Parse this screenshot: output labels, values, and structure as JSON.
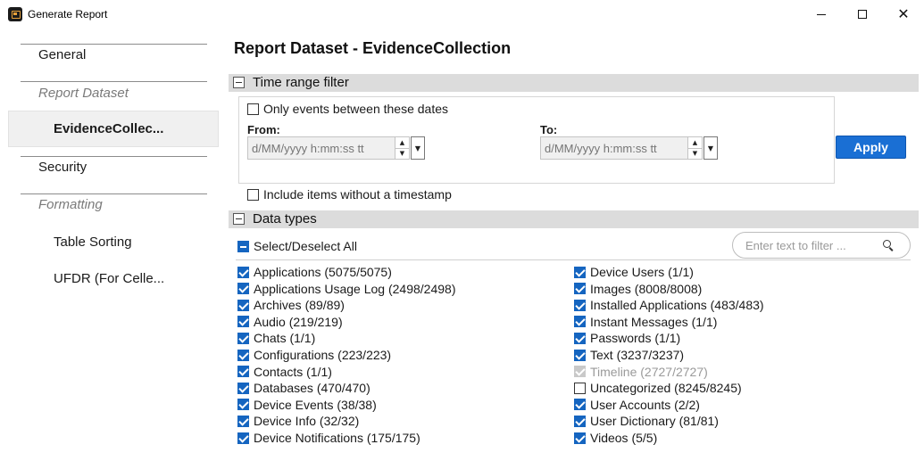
{
  "window": {
    "title": "Generate Report",
    "icon": "report-app-icon",
    "controls": [
      "minimize",
      "maximize",
      "close"
    ],
    "close_glyph": "✕"
  },
  "nav": {
    "general": "General",
    "report_dataset": "Report Dataset",
    "evidence": "EvidenceCollec...",
    "security": "Security",
    "formatting": "Formatting",
    "table_sorting": "Table Sorting",
    "ufdr": "UFDR (For Celle..."
  },
  "main": {
    "title": "Report Dataset - EvidenceCollection",
    "time_range": {
      "section_title": "Time range filter",
      "only_events_label": "Only events between these dates",
      "only_events_checked": false,
      "from_label": "From:",
      "to_label": "To:",
      "date_placeholder": "d/MM/yyyy h:mm:ss tt",
      "apply_label": "Apply",
      "include_label": "Include items without a timestamp",
      "include_checked": false
    },
    "data_types": {
      "section_title": "Data types",
      "select_all_label": "Select/Deselect All",
      "select_all_state": "indeterminate",
      "filter_placeholder": "Enter text to filter ...",
      "left_items": [
        {
          "label": "Applications (5075/5075)",
          "checked": true
        },
        {
          "label": "Applications Usage Log (2498/2498)",
          "checked": true
        },
        {
          "label": "Archives (89/89)",
          "checked": true
        },
        {
          "label": "Audio (219/219)",
          "checked": true
        },
        {
          "label": "Chats (1/1)",
          "checked": true
        },
        {
          "label": "Configurations (223/223)",
          "checked": true
        },
        {
          "label": "Contacts (1/1)",
          "checked": true
        },
        {
          "label": "Databases (470/470)",
          "checked": true
        },
        {
          "label": "Device Events (38/38)",
          "checked": true
        },
        {
          "label": "Device Info (32/32)",
          "checked": true
        },
        {
          "label": "Device Notifications (175/175)",
          "checked": true
        }
      ],
      "right_items": [
        {
          "label": "Device Users (1/1)",
          "checked": true
        },
        {
          "label": "Images (8008/8008)",
          "checked": true
        },
        {
          "label": "Installed Applications (483/483)",
          "checked": true
        },
        {
          "label": "Instant Messages (1/1)",
          "checked": true
        },
        {
          "label": "Passwords (1/1)",
          "checked": true
        },
        {
          "label": "Text (3237/3237)",
          "checked": true
        },
        {
          "label": "Timeline (2727/2727)",
          "checked": true,
          "disabled": true
        },
        {
          "label": "Uncategorized (8245/8245)",
          "checked": false
        },
        {
          "label": "User Accounts (2/2)",
          "checked": true
        },
        {
          "label": "User Dictionary (81/81)",
          "checked": true
        },
        {
          "label": "Videos (5/5)",
          "checked": true
        }
      ]
    }
  },
  "colors": {
    "accent": "#1a6fd4",
    "checkbox_checked": "#1565c0",
    "section_bar": "#dcdcdc",
    "selected_nav": "#f0f0f0"
  }
}
